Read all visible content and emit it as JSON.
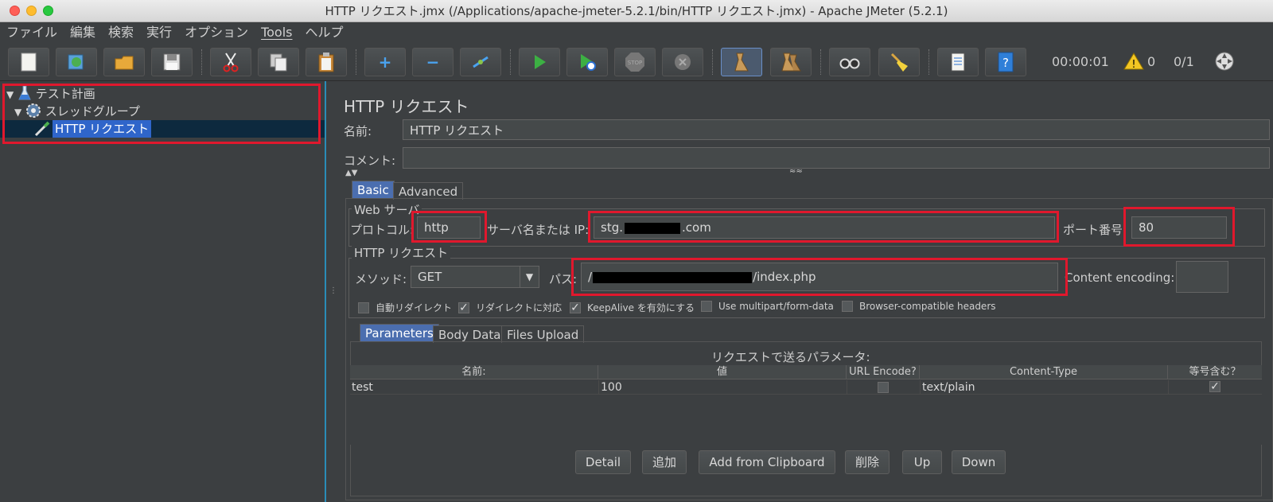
{
  "window": {
    "title": "HTTP リクエスト.jmx (/Applications/apache-jmeter-5.2.1/bin/HTTP リクエスト.jmx) - Apache JMeter (5.2.1)"
  },
  "menu": [
    "ファイル",
    "編集",
    "検索",
    "実行",
    "オプション",
    "Tools",
    "ヘルプ"
  ],
  "toolbar": {
    "icons": [
      "new-file-icon",
      "templates-icon",
      "open-icon",
      "save-icon",
      "cut-icon",
      "copy-icon",
      "paste-icon",
      "expand-icon",
      "collapse-icon",
      "toggle-icon",
      "start-icon",
      "start-no-pause-icon",
      "stop-icon",
      "shutdown-icon",
      "clear-icon",
      "clear-all-icon",
      "search-icon",
      "reset-search-icon",
      "function-helper-icon",
      "help-icon"
    ],
    "elapsed": "00:00:01",
    "warnings": "0",
    "threads": "0/1"
  },
  "tree": {
    "items": [
      {
        "label": "テスト計画",
        "icon": "test-plan-icon"
      },
      {
        "label": "スレッドグループ",
        "icon": "thread-group-gear-icon"
      },
      {
        "label": "HTTP リクエスト",
        "icon": "sampler-pipette-icon"
      }
    ]
  },
  "panel": {
    "title": "HTTP リクエスト",
    "name_label": "名前:",
    "name_value": "HTTP リクエスト",
    "comment_label": "コメント:",
    "comment_value": "",
    "tabs": [
      "Basic",
      "Advanced"
    ],
    "web_server": {
      "group_title": "Web サーバ",
      "protocol_label": "プロトコル:",
      "protocol_value": "http",
      "server_label": "サーバ名または IP:",
      "server_prefix": "stg.",
      "server_suffix": ".com",
      "port_label": "ポート番号:",
      "port_value": "80"
    },
    "http_request": {
      "group_title": "HTTP リクエスト",
      "method_label": "メソッド:",
      "method_value": "GET",
      "path_label": "パス:",
      "path_prefix": "/",
      "path_suffix": "/index.php",
      "encoding_label": "Content encoding:",
      "encoding_value": ""
    },
    "options": [
      {
        "label": "自動リダイレクト",
        "checked": false
      },
      {
        "label": "リダイレクトに対応",
        "checked": true
      },
      {
        "label": "KeepAlive を有効にする",
        "checked": true
      },
      {
        "label": "Use multipart/form-data",
        "checked": false
      },
      {
        "label": "Browser-compatible headers",
        "checked": false
      }
    ],
    "sub_tabs": [
      "Parameters",
      "Body Data",
      "Files Upload"
    ],
    "params_title": "リクエストで送るパラメータ:",
    "table": {
      "headers": [
        "名前:",
        "値",
        "URL Encode?",
        "Content-Type",
        "等号含む？"
      ],
      "rows": [
        {
          "name": "test",
          "value": "100",
          "url_encode": false,
          "content_type": "text/plain",
          "include_equals": true
        }
      ]
    },
    "buttons": [
      "Detail",
      "追加",
      "Add from Clipboard",
      "削除",
      "Up",
      "Down"
    ]
  },
  "colors": {
    "background": "#3c3f41",
    "selection": "#2f65ca",
    "highlight_red": "#e0182d",
    "tab_selected": "#4b6eaf"
  }
}
